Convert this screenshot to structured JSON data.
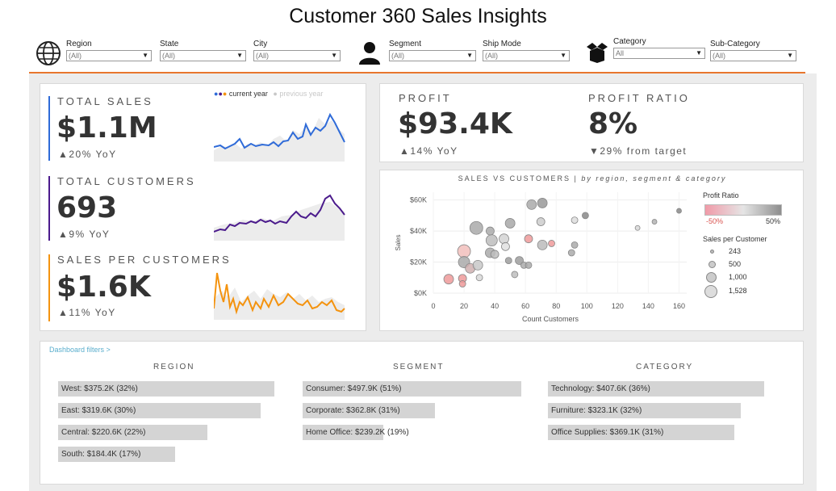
{
  "title": "Customer 360 Sales Insights",
  "filters": [
    {
      "label": "Region",
      "value": "(All)"
    },
    {
      "label": "State",
      "value": "(All)"
    },
    {
      "label": "City",
      "value": "(All)"
    },
    {
      "label": "Segment",
      "value": "(All)"
    },
    {
      "label": "Ship Mode",
      "value": "(All)"
    },
    {
      "label": "Category",
      "value": "All"
    },
    {
      "label": "Sub-Category",
      "value": "(All)"
    }
  ],
  "kpis": {
    "total_sales": {
      "label": "TOTAL SALES",
      "value": "$1.1M",
      "yoy": "▲20% YoY",
      "color": "#2f6bd8"
    },
    "total_customers": {
      "label": "TOTAL CUSTOMERS",
      "value": "693",
      "yoy": "▲9% YoY",
      "color": "#4b1b8c"
    },
    "sales_per_customer": {
      "label": "SALES PER CUSTOMERS",
      "value": "$1.6K",
      "yoy": "▲11% YoY",
      "color": "#f4930f"
    },
    "legend_current": "current year",
    "legend_previous": "previous year"
  },
  "profit": {
    "label": "PROFIT",
    "value": "$93.4K",
    "yoy": "▲14% YoY"
  },
  "profit_ratio": {
    "label": "PROFIT RATIO",
    "value": "8%",
    "target": "▼29% from target"
  },
  "scatter": {
    "title": "SALES VS CUSTOMERS",
    "subtitle": "by region, segment & category",
    "x_label": "Count Customers",
    "y_label": "Sales",
    "x_ticks": [
      "0",
      "20",
      "40",
      "60",
      "80",
      "100",
      "120",
      "140",
      "160"
    ],
    "y_ticks": [
      "$0K",
      "$20K",
      "$40K",
      "$60K"
    ],
    "legend_ratio_title": "Profit Ratio",
    "legend_ratio_min": "-50%",
    "legend_ratio_max": "50%",
    "legend_size_title": "Sales per Customer",
    "legend_sizes": [
      "243",
      "500",
      "1,000",
      "1,528"
    ]
  },
  "chart_data": {
    "type": "scatter",
    "x_range": [
      0,
      165
    ],
    "y_range": [
      0,
      65000
    ],
    "points": [
      {
        "x": 10,
        "y": 9000,
        "r": 6,
        "color": "#ee9a9a"
      },
      {
        "x": 19,
        "y": 9500,
        "r": 5,
        "color": "#ee9a9a"
      },
      {
        "x": 19,
        "y": 6000,
        "r": 4,
        "color": "#ee9a9a"
      },
      {
        "x": 20,
        "y": 27000,
        "r": 8,
        "color": "#f2c0bc"
      },
      {
        "x": 20,
        "y": 20000,
        "r": 7,
        "color": "#aaaaaa"
      },
      {
        "x": 24,
        "y": 16000,
        "r": 6,
        "color": "#cfb0b0"
      },
      {
        "x": 28,
        "y": 42000,
        "r": 8,
        "color": "#aaaaaa"
      },
      {
        "x": 29,
        "y": 18000,
        "r": 6,
        "color": "#c8c8c8"
      },
      {
        "x": 30,
        "y": 10000,
        "r": 4,
        "color": "#d8d8d8"
      },
      {
        "x": 37,
        "y": 26000,
        "r": 6,
        "color": "#aaaaaa"
      },
      {
        "x": 38,
        "y": 34000,
        "r": 7,
        "color": "#bdbdbd"
      },
      {
        "x": 37,
        "y": 40000,
        "r": 5,
        "color": "#aaaaaa"
      },
      {
        "x": 40,
        "y": 25000,
        "r": 5,
        "color": "#bdbdbd"
      },
      {
        "x": 46,
        "y": 35000,
        "r": 6,
        "color": "#d3d3d3"
      },
      {
        "x": 47,
        "y": 30000,
        "r": 5,
        "color": "#e0e0e0"
      },
      {
        "x": 49,
        "y": 21000,
        "r": 4,
        "color": "#9e9e9e"
      },
      {
        "x": 50,
        "y": 45000,
        "r": 6,
        "color": "#a8a8a8"
      },
      {
        "x": 53,
        "y": 12000,
        "r": 4,
        "color": "#bdbdbd"
      },
      {
        "x": 56,
        "y": 21000,
        "r": 5,
        "color": "#9e9e9e"
      },
      {
        "x": 59,
        "y": 18000,
        "r": 4,
        "color": "#aaaaaa"
      },
      {
        "x": 62,
        "y": 18000,
        "r": 4,
        "color": "#aaaaaa"
      },
      {
        "x": 62,
        "y": 35000,
        "r": 5,
        "color": "#ee9a9a"
      },
      {
        "x": 64,
        "y": 57000,
        "r": 6,
        "color": "#aaaaaa"
      },
      {
        "x": 70,
        "y": 46000,
        "r": 5,
        "color": "#cccccc"
      },
      {
        "x": 71,
        "y": 31000,
        "r": 6,
        "color": "#bbbbbb"
      },
      {
        "x": 71,
        "y": 58000,
        "r": 6,
        "color": "#999999"
      },
      {
        "x": 77,
        "y": 32000,
        "r": 4,
        "color": "#ee9a9a"
      },
      {
        "x": 90,
        "y": 26000,
        "r": 4,
        "color": "#aaaaaa"
      },
      {
        "x": 92,
        "y": 31000,
        "r": 4,
        "color": "#aaaaaa"
      },
      {
        "x": 92,
        "y": 47000,
        "r": 4,
        "color": "#dddddd"
      },
      {
        "x": 99,
        "y": 50000,
        "r": 4,
        "color": "#888888"
      },
      {
        "x": 133,
        "y": 42000,
        "r": 3,
        "color": "#d8d8d8"
      },
      {
        "x": 144,
        "y": 46000,
        "r": 3,
        "color": "#b4b4b4"
      },
      {
        "x": 160,
        "y": 53000,
        "r": 3,
        "color": "#888888"
      }
    ]
  },
  "breakdown": {
    "link": "Dashboard filters >",
    "region": {
      "title": "REGION",
      "items": [
        {
          "label": "West: $375.2K (32%)",
          "share": 32
        },
        {
          "label": "East: $319.6K (30%)",
          "share": 30
        },
        {
          "label": "Central: $220.6K (22%)",
          "share": 22
        },
        {
          "label": "South: $184.4K (17%)",
          "share": 17
        }
      ]
    },
    "segment": {
      "title": "SEGMENT",
      "items": [
        {
          "label": "Consumer: $497.9K (51%)",
          "share": 51
        },
        {
          "label": "Corporate: $362.8K (31%)",
          "share": 31
        },
        {
          "label": "Home Office: $239.2K (19%)",
          "share": 19
        }
      ]
    },
    "category": {
      "title": "CATEGORY",
      "items": [
        {
          "label": "Technology: $407.6K (36%)",
          "share": 36
        },
        {
          "label": "Furniture: $323.1K (32%)",
          "share": 32
        },
        {
          "label": "Office Supplies: $369.1K (31%)",
          "share": 31
        }
      ]
    }
  }
}
